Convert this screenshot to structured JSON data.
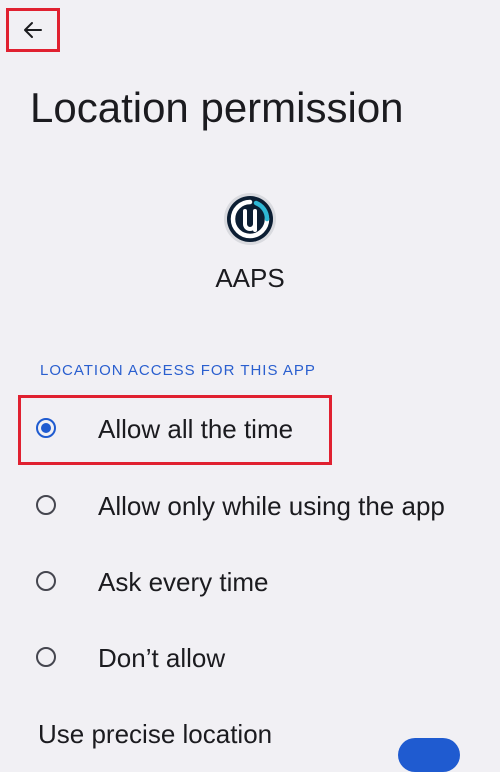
{
  "header": {
    "back_icon": "arrow-left-icon",
    "title": "Location permission"
  },
  "app": {
    "icon": "aaps-logo-icon",
    "name": "AAPS"
  },
  "permissions": {
    "section_header": "LOCATION ACCESS FOR THIS APP",
    "options": [
      {
        "label": "Allow all the time",
        "selected": true
      },
      {
        "label": "Allow only while using the app",
        "selected": false
      },
      {
        "label": "Ask every time",
        "selected": false
      },
      {
        "label": "Don’t allow",
        "selected": false
      }
    ]
  },
  "precise_location": {
    "label": "Use precise location",
    "enabled": true
  },
  "colors": {
    "accent": "#1f5bd0",
    "highlight": "#e02030",
    "background": "#f1f0f4"
  }
}
